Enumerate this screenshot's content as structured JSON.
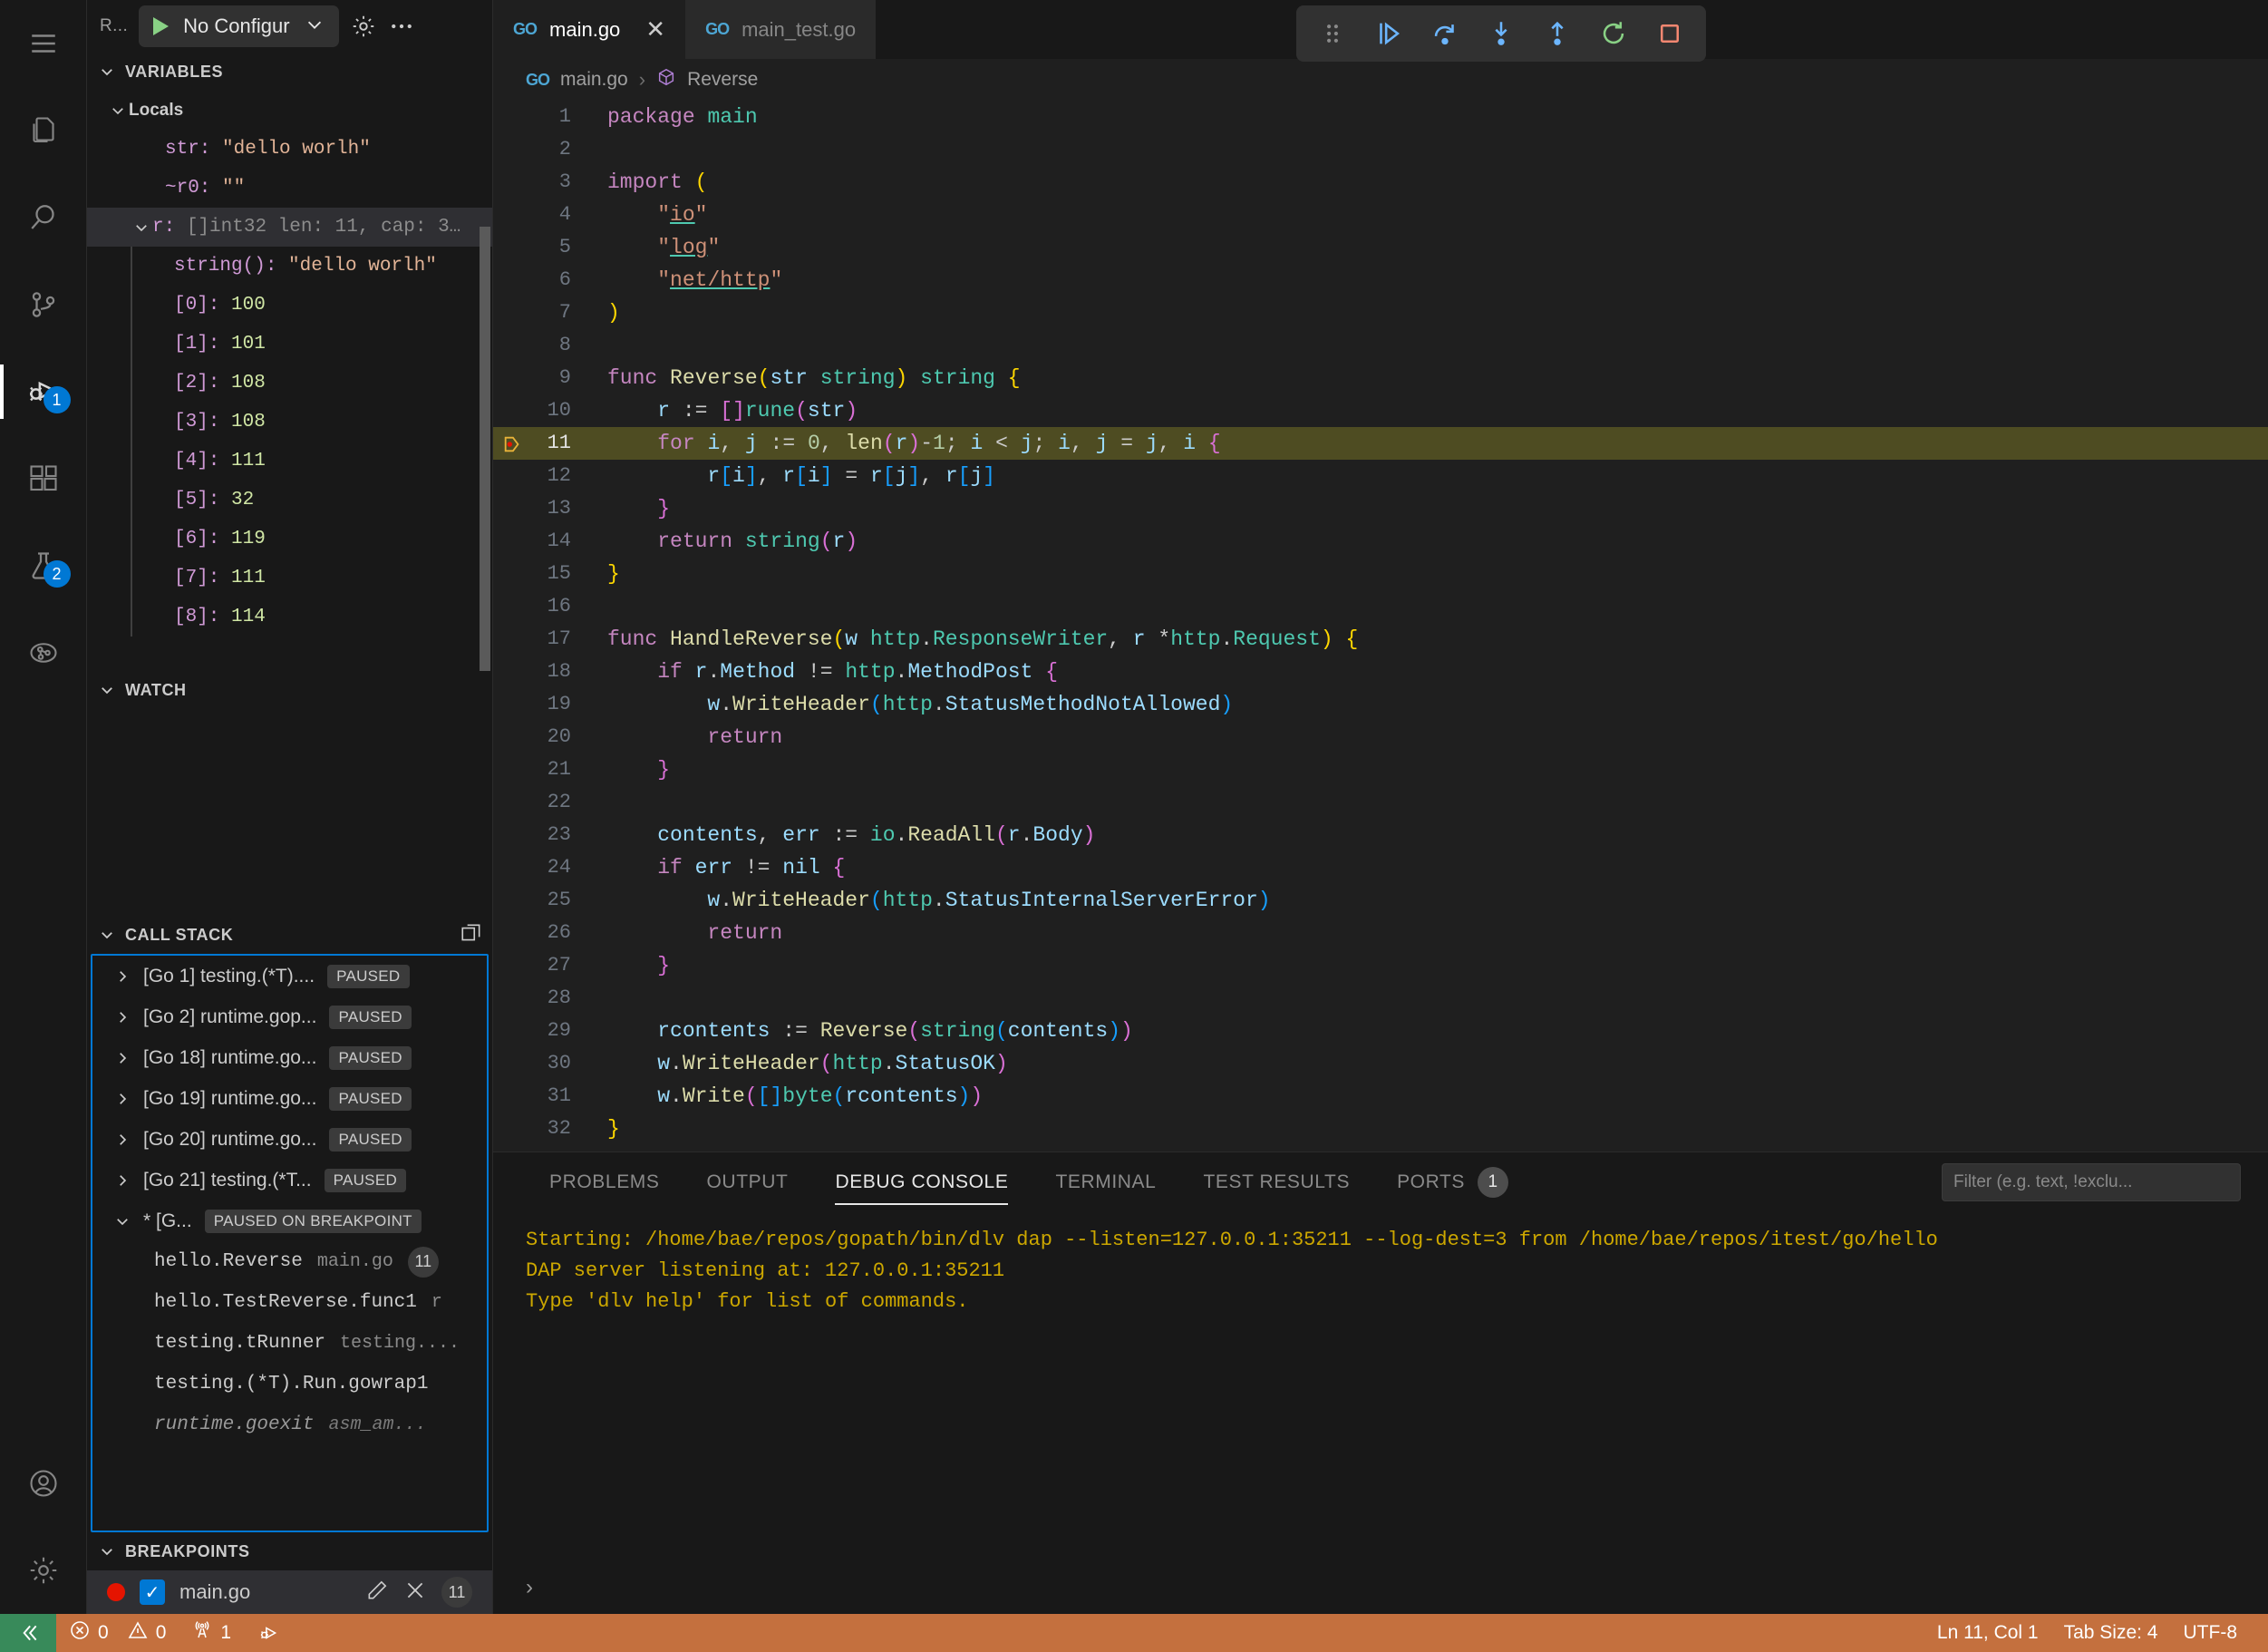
{
  "activitybar": {
    "items": [
      {
        "name": "menu-icon",
        "label": "Menu"
      },
      {
        "name": "explorer-icon",
        "label": "Explorer"
      },
      {
        "name": "search-icon",
        "label": "Search"
      },
      {
        "name": "source-control-icon",
        "label": "Source Control"
      },
      {
        "name": "run-and-debug-icon",
        "label": "Run and Debug",
        "badge": "1"
      },
      {
        "name": "extensions-icon",
        "label": "Extensions"
      },
      {
        "name": "testing-icon",
        "label": "Testing",
        "badge": "2"
      },
      {
        "name": "remote-explorer-icon",
        "label": "Remote Explorer"
      },
      {
        "name": "accounts-icon",
        "label": "Accounts"
      },
      {
        "name": "settings-gear-icon",
        "label": "Manage"
      }
    ]
  },
  "sidebar": {
    "title": "R...",
    "config_label": "No Configur",
    "variables": {
      "header": "VARIABLES",
      "group": "Locals",
      "rows": [
        {
          "kind": "var",
          "name": "str:",
          "value": "\"dello worlh\"",
          "vtype": "str"
        },
        {
          "kind": "var",
          "name": "~r0:",
          "value": "\"\"",
          "vtype": "str"
        },
        {
          "kind": "expandable",
          "name": "r:",
          "value": "[]int32 len: 11, cap: 3…",
          "vtype": "type",
          "selected": true
        },
        {
          "kind": "child",
          "name": "string():",
          "value": "\"dello worlh\"",
          "vtype": "str"
        },
        {
          "kind": "child",
          "name": "[0]:",
          "value": "100",
          "vtype": "num"
        },
        {
          "kind": "child",
          "name": "[1]:",
          "value": "101",
          "vtype": "num"
        },
        {
          "kind": "child",
          "name": "[2]:",
          "value": "108",
          "vtype": "num"
        },
        {
          "kind": "child",
          "name": "[3]:",
          "value": "108",
          "vtype": "num"
        },
        {
          "kind": "child",
          "name": "[4]:",
          "value": "111",
          "vtype": "num"
        },
        {
          "kind": "child",
          "name": "[5]:",
          "value": "32",
          "vtype": "num"
        },
        {
          "kind": "child",
          "name": "[6]:",
          "value": "119",
          "vtype": "num"
        },
        {
          "kind": "child",
          "name": "[7]:",
          "value": "111",
          "vtype": "num"
        },
        {
          "kind": "child",
          "name": "[8]:",
          "value": "114",
          "vtype": "num"
        }
      ]
    },
    "watch": {
      "header": "WATCH"
    },
    "callstack": {
      "header": "CALL STACK",
      "threads": [
        {
          "label": "[Go 1] testing.(*T)....",
          "status": "PAUSED",
          "expanded": false
        },
        {
          "label": "[Go 2] runtime.gop...",
          "status": "PAUSED",
          "expanded": false
        },
        {
          "label": "[Go 18] runtime.go...",
          "status": "PAUSED",
          "expanded": false
        },
        {
          "label": "[Go 19] runtime.go...",
          "status": "PAUSED",
          "expanded": false
        },
        {
          "label": "[Go 20] runtime.go...",
          "status": "PAUSED",
          "expanded": false
        },
        {
          "label": "[Go 21] testing.(*T...",
          "status": "PAUSED",
          "expanded": false
        },
        {
          "label": "* [G...",
          "status": "PAUSED ON BREAKPOINT",
          "expanded": true
        }
      ],
      "frames": [
        {
          "fn": "hello.Reverse",
          "file": "main.go",
          "line": "11",
          "dim": false
        },
        {
          "fn": "hello.TestReverse.func1",
          "file": "r",
          "line": "",
          "dim": false
        },
        {
          "fn": "testing.tRunner",
          "file": "testing....",
          "line": "",
          "dim": false
        },
        {
          "fn": "testing.(*T).Run.gowrap1",
          "file": "",
          "line": "",
          "dim": false
        },
        {
          "fn": "runtime.goexit",
          "file": "asm_am...",
          "line": "",
          "dim": true
        }
      ]
    },
    "breakpoints": {
      "header": "BREAKPOINTS",
      "items": [
        {
          "file": "main.go",
          "line": "11",
          "enabled": true,
          "checkmark": "✓"
        }
      ]
    }
  },
  "editor": {
    "tabs": [
      {
        "label": "main.go",
        "active": true,
        "icon": "go-file-icon",
        "close": "✕"
      },
      {
        "label": "main_test.go",
        "active": false,
        "icon": "go-file-icon",
        "close": ""
      }
    ],
    "breadcrumb": {
      "file": "main.go",
      "separator": "›",
      "symbol": "Reverse"
    },
    "debug_toolbar": [
      {
        "name": "drag-handle-icon"
      },
      {
        "name": "continue-icon"
      },
      {
        "name": "step-over-icon"
      },
      {
        "name": "step-into-icon"
      },
      {
        "name": "step-out-icon"
      },
      {
        "name": "restart-icon"
      },
      {
        "name": "stop-icon"
      }
    ],
    "lines": [
      {
        "n": "1",
        "html": "<span class=\"t-kw\">package</span> <span class=\"t-type\">main</span>"
      },
      {
        "n": "2",
        "html": ""
      },
      {
        "n": "3",
        "html": "<span class=\"t-kw\">import</span> <span class=\"t-paren1\">(</span>"
      },
      {
        "n": "4",
        "html": "    <span class=\"t-str\">\"</span><span class=\"t-str u-io\">io</span><span class=\"t-str\">\"</span>"
      },
      {
        "n": "5",
        "html": "    <span class=\"t-str\">\"</span><span class=\"t-str u-io\">log</span><span class=\"t-str\">\"</span>"
      },
      {
        "n": "6",
        "html": "    <span class=\"t-str\">\"</span><span class=\"t-str u-io\">net/http</span><span class=\"t-str\">\"</span>"
      },
      {
        "n": "7",
        "html": "<span class=\"t-paren1\">)</span>"
      },
      {
        "n": "8",
        "html": ""
      },
      {
        "n": "9",
        "html": "<span class=\"t-kw\">func</span> <span class=\"t-fn\">Reverse</span><span class=\"t-paren1\">(</span><span class=\"t-var\">str</span> <span class=\"t-type\">string</span><span class=\"t-paren1\">)</span> <span class=\"t-type\">string</span> <span class=\"t-paren1\">{</span>"
      },
      {
        "n": "10",
        "html": "    <span class=\"t-var\">r</span> <span class=\"t-punct\">:=</span> <span class=\"t-paren2\">[]</span><span class=\"t-type\">rune</span><span class=\"t-paren2\">(</span><span class=\"t-var\">str</span><span class=\"t-paren2\">)</span>"
      },
      {
        "n": "11",
        "html": "    <span class=\"t-kw\">for</span> <span class=\"t-var\">i</span><span class=\"t-punct\">,</span> <span class=\"t-var\">j</span> <span class=\"t-punct\">:=</span> <span class=\"t-num\">0</span><span class=\"t-punct\">,</span> <span class=\"t-fn\">len</span><span class=\"t-paren2\">(</span><span class=\"t-var\">r</span><span class=\"t-paren2\">)</span><span class=\"t-punct\">-</span><span class=\"t-num\">1</span><span class=\"t-punct\">;</span> <span class=\"t-var\">i</span> <span class=\"t-punct\">&lt;</span> <span class=\"t-var\">j</span><span class=\"t-punct\">;</span> <span class=\"t-var\">i</span><span class=\"t-punct\">,</span> <span class=\"t-var\">j</span> <span class=\"t-punct\">=</span> <span class=\"t-var\">j</span><span class=\"t-punct\">,</span> <span class=\"t-var\">i</span> <span class=\"t-paren2\">{</span>",
        "highlight": true,
        "breakpoint": true
      },
      {
        "n": "12",
        "html": "        <span class=\"t-var\">r</span><span class=\"t-paren3\">[</span><span class=\"t-var\">i</span><span class=\"t-paren3\">]</span><span class=\"t-punct\">,</span> <span class=\"t-var\">r</span><span class=\"t-paren3\">[</span><span class=\"t-var\">i</span><span class=\"t-paren3\">]</span> <span class=\"t-punct\">=</span> <span class=\"t-var\">r</span><span class=\"t-paren3\">[</span><span class=\"t-var\">j</span><span class=\"t-paren3\">]</span><span class=\"t-punct\">,</span> <span class=\"t-var\">r</span><span class=\"t-paren3\">[</span><span class=\"t-var\">j</span><span class=\"t-paren3\">]</span>"
      },
      {
        "n": "13",
        "html": "    <span class=\"t-paren2\">}</span>"
      },
      {
        "n": "14",
        "html": "    <span class=\"t-kw\">return</span> <span class=\"t-type\">string</span><span class=\"t-paren2\">(</span><span class=\"t-var\">r</span><span class=\"t-paren2\">)</span>"
      },
      {
        "n": "15",
        "html": "<span class=\"t-paren1\">}</span>"
      },
      {
        "n": "16",
        "html": ""
      },
      {
        "n": "17",
        "html": "<span class=\"t-kw\">func</span> <span class=\"t-fn\">HandleReverse</span><span class=\"t-paren1\">(</span><span class=\"t-var\">w</span> <span class=\"t-type\">http</span><span class=\"t-punct\">.</span><span class=\"t-type\">ResponseWriter</span><span class=\"t-punct\">,</span> <span class=\"t-var\">r</span> <span class=\"t-punct\">*</span><span class=\"t-type\">http</span><span class=\"t-punct\">.</span><span class=\"t-type\">Request</span><span class=\"t-paren1\">)</span> <span class=\"t-paren1\">{</span>"
      },
      {
        "n": "18",
        "html": "    <span class=\"t-kw\">if</span> <span class=\"t-var\">r</span><span class=\"t-punct\">.</span><span class=\"t-var\">Method</span> <span class=\"t-punct\">!=</span> <span class=\"t-type\">http</span><span class=\"t-punct\">.</span><span class=\"t-var\">MethodPost</span> <span class=\"t-paren2\">{</span>"
      },
      {
        "n": "19",
        "html": "        <span class=\"t-var\">w</span><span class=\"t-punct\">.</span><span class=\"t-fn\">WriteHeader</span><span class=\"t-paren3\">(</span><span class=\"t-type\">http</span><span class=\"t-punct\">.</span><span class=\"t-var\">StatusMethodNotAllowed</span><span class=\"t-paren3\">)</span>"
      },
      {
        "n": "20",
        "html": "        <span class=\"t-kw\">return</span>"
      },
      {
        "n": "21",
        "html": "    <span class=\"t-paren2\">}</span>"
      },
      {
        "n": "22",
        "html": ""
      },
      {
        "n": "23",
        "html": "    <span class=\"t-var\">contents</span><span class=\"t-punct\">,</span> <span class=\"t-var\">err</span> <span class=\"t-punct\">:=</span> <span class=\"t-type\">io</span><span class=\"t-punct\">.</span><span class=\"t-fn\">ReadAll</span><span class=\"t-paren2\">(</span><span class=\"t-var\">r</span><span class=\"t-punct\">.</span><span class=\"t-var\">Body</span><span class=\"t-paren2\">)</span>"
      },
      {
        "n": "24",
        "html": "    <span class=\"t-kw\">if</span> <span class=\"t-var\">err</span> <span class=\"t-punct\">!=</span> <span class=\"t-var\">nil</span> <span class=\"t-paren2\">{</span>"
      },
      {
        "n": "25",
        "html": "        <span class=\"t-var\">w</span><span class=\"t-punct\">.</span><span class=\"t-fn\">WriteHeader</span><span class=\"t-paren3\">(</span><span class=\"t-type\">http</span><span class=\"t-punct\">.</span><span class=\"t-var\">StatusInternalServerError</span><span class=\"t-paren3\">)</span>"
      },
      {
        "n": "26",
        "html": "        <span class=\"t-kw\">return</span>"
      },
      {
        "n": "27",
        "html": "    <span class=\"t-paren2\">}</span>"
      },
      {
        "n": "28",
        "html": ""
      },
      {
        "n": "29",
        "html": "    <span class=\"t-var\">rcontents</span> <span class=\"t-punct\">:=</span> <span class=\"t-fn\">Reverse</span><span class=\"t-paren2\">(</span><span class=\"t-type\">string</span><span class=\"t-paren3\">(</span><span class=\"t-var\">contents</span><span class=\"t-paren3\">)</span><span class=\"t-paren2\">)</span>"
      },
      {
        "n": "30",
        "html": "    <span class=\"t-var\">w</span><span class=\"t-punct\">.</span><span class=\"t-fn\">WriteHeader</span><span class=\"t-paren2\">(</span><span class=\"t-type\">http</span><span class=\"t-punct\">.</span><span class=\"t-var\">StatusOK</span><span class=\"t-paren2\">)</span>"
      },
      {
        "n": "31",
        "html": "    <span class=\"t-var\">w</span><span class=\"t-punct\">.</span><span class=\"t-fn\">Write</span><span class=\"t-paren2\">(</span><span class=\"t-paren3\">[]</span><span class=\"t-type\">byte</span><span class=\"t-paren3\">(</span><span class=\"t-var\">rcontents</span><span class=\"t-paren3\">)</span><span class=\"t-paren2\">)</span>"
      },
      {
        "n": "32",
        "html": "<span class=\"t-paren1\">}</span>"
      }
    ]
  },
  "panel": {
    "tabs": [
      {
        "label": "PROBLEMS",
        "active": false
      },
      {
        "label": "OUTPUT",
        "active": false
      },
      {
        "label": "DEBUG CONSOLE",
        "active": true
      },
      {
        "label": "TERMINAL",
        "active": false
      },
      {
        "label": "TEST RESULTS",
        "active": false
      },
      {
        "label": "PORTS",
        "active": false,
        "badge": "1"
      }
    ],
    "filter_placeholder": "Filter (e.g. text, !exclu...",
    "console_lines": [
      "Starting: /home/bae/repos/gopath/bin/dlv dap --listen=127.0.0.1:35211 --log-dest=3 from /home/bae/repos/itest/go/hello",
      "DAP server listening at: 127.0.0.1:35211",
      "Type 'dlv help' for list of commands."
    ],
    "prompt_symbol": "›"
  },
  "statusbar": {
    "remote_icon": "remote-window-icon",
    "errors": "0",
    "warnings": "0",
    "ports": "1",
    "debug_icon": "debug-start-icon",
    "position": "Ln 11, Col 1",
    "tabsize": "Tab Size: 4",
    "encoding": "UTF-8"
  },
  "colors": {
    "accent": "#0078d4",
    "statusbar_bg": "#c4703e",
    "remote_bg": "#388a5a",
    "breakpoint": "#e51400",
    "highlight_line": "#4e4c22"
  }
}
